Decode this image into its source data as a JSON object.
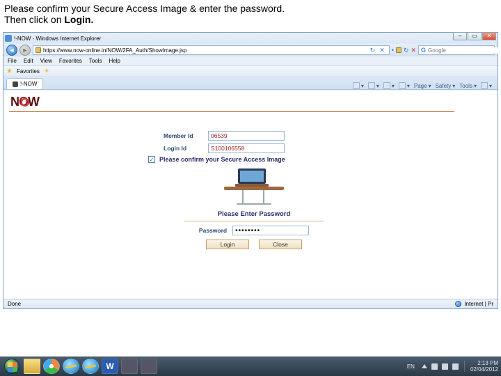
{
  "instruction": {
    "line1a": "Please confirm your Secure Access Image  &  enter the password.",
    "line2a": "Then click on ",
    "line2b": "Login."
  },
  "window_title": "!-NOW - Windows Internet Explorer",
  "address_url": "https://www.now-online.in/NOW/2FA_Auth/ShowImage.jsp",
  "search_placeholder": "Google",
  "menus": [
    "File",
    "Edit",
    "View",
    "Favorites",
    "Tools",
    "Help"
  ],
  "favorites_label": "Favorites",
  "tab_label": "!-NOW",
  "tab_tools": {
    "home": "",
    "feeds": "",
    "mail": "",
    "print": "",
    "page": "Page",
    "safety": "Safety",
    "tools": "Tools"
  },
  "logo_text": {
    "n": "N",
    "o": "O",
    "w": "W"
  },
  "form": {
    "member_label": "Member Id",
    "member_value": "06539",
    "login_label": "Login Id",
    "login_value": "S100106558",
    "confirm_text": "Please confirm your Secure Access Image",
    "enter_pw": "Please Enter Password",
    "pw_label": "Password",
    "pw_value": "••••••••",
    "btn_login": "Login",
    "btn_close": "Close"
  },
  "status": {
    "left": "Done",
    "right": "Internet | Pr"
  },
  "tray": {
    "lang": "EN",
    "time": "2:13 PM",
    "date": "02/04/2012"
  }
}
